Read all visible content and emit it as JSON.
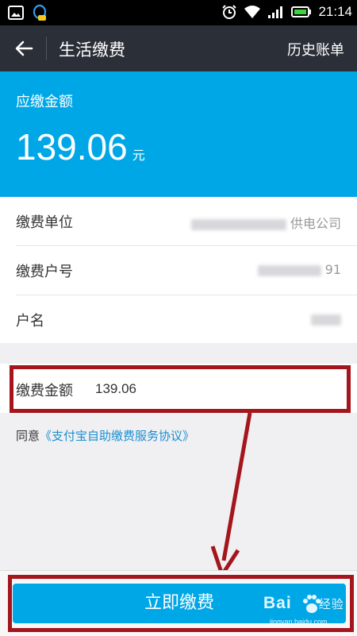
{
  "status_bar": {
    "time": "21:14"
  },
  "nav": {
    "title": "生活缴费",
    "history_label": "历史账单"
  },
  "amount_header": {
    "label": "应缴金额",
    "value": "139.06",
    "unit": "元"
  },
  "info": [
    {
      "label": "缴费单位",
      "value_visible": "供电公司"
    },
    {
      "label": "缴费户号",
      "value_visible": "91"
    },
    {
      "label": "户名",
      "value_visible": ""
    }
  ],
  "pay_amount": {
    "label": "缴费金额",
    "value": "139.06"
  },
  "agreement": {
    "prefix": "同意",
    "link": "《支付宝自助缴费服务协议》"
  },
  "pay_button": {
    "label": "立即缴费"
  },
  "watermark": {
    "text": "Bai",
    "suffix": "经验",
    "url": "jingyan.baidu.com"
  },
  "colors": {
    "primary": "#00a7e6",
    "nav_bg": "#2b2f38",
    "annotation": "#a4151c",
    "link": "#1a8fd0"
  }
}
